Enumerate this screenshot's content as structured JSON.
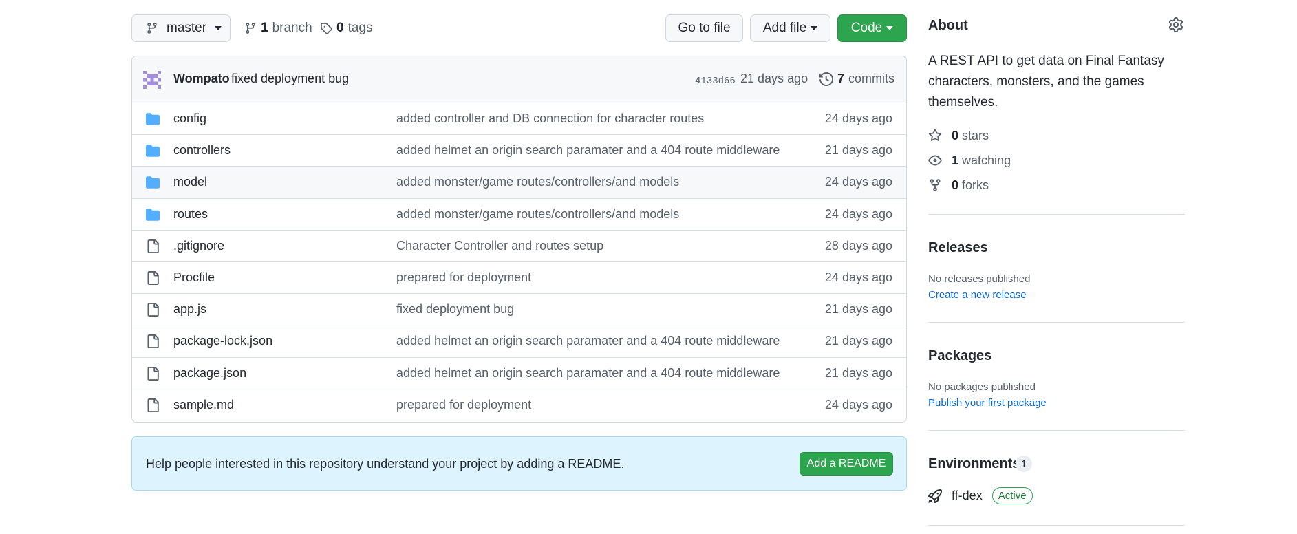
{
  "toolbar": {
    "branch_name": "master",
    "branch_count": "1",
    "branch_label": "branch",
    "tag_count": "0",
    "tag_label": "tags",
    "go_to_file": "Go to file",
    "add_file": "Add file",
    "code": "Code"
  },
  "commit": {
    "author": "Wompato",
    "message": "fixed deployment bug",
    "sha": "4133d66",
    "age": "21 days ago",
    "count": "7",
    "count_label": "commits"
  },
  "files": [
    {
      "name": "config",
      "type": "folder",
      "message": "added controller and DB connection for character routes",
      "age": "24 days ago"
    },
    {
      "name": "controllers",
      "type": "folder",
      "message": "added helmet an origin search paramater and a 404 route middleware",
      "age": "21 days ago"
    },
    {
      "name": "model",
      "type": "folder",
      "message": "added monster/game routes/controllers/and models",
      "age": "24 days ago"
    },
    {
      "name": "routes",
      "type": "folder",
      "message": "added monster/game routes/controllers/and models",
      "age": "24 days ago"
    },
    {
      "name": ".gitignore",
      "type": "file",
      "message": "Character Controller and routes setup",
      "age": "28 days ago"
    },
    {
      "name": "Procfile",
      "type": "file",
      "message": "prepared for deployment",
      "age": "24 days ago"
    },
    {
      "name": "app.js",
      "type": "file",
      "message": "fixed deployment bug",
      "age": "21 days ago"
    },
    {
      "name": "package-lock.json",
      "type": "file",
      "message": "added helmet an origin search paramater and a 404 route middleware",
      "age": "21 days ago"
    },
    {
      "name": "package.json",
      "type": "file",
      "message": "added helmet an origin search paramater and a 404 route middleware",
      "age": "21 days ago"
    },
    {
      "name": "sample.md",
      "type": "file",
      "message": "prepared for deployment",
      "age": "24 days ago"
    }
  ],
  "readme": {
    "text": "Help people interested in this repository understand your project by adding a README.",
    "button": "Add a README"
  },
  "about": {
    "title": "About",
    "description": "A REST API to get data on Final Fantasy characters, monsters, and the games themselves.",
    "stars_count": "0",
    "stars_label": "stars",
    "watching_count": "1",
    "watching_label": "watching",
    "forks_count": "0",
    "forks_label": "forks"
  },
  "releases": {
    "title": "Releases",
    "empty": "No releases published",
    "link": "Create a new release"
  },
  "packages": {
    "title": "Packages",
    "empty": "No packages published",
    "link": "Publish your first package"
  },
  "environments": {
    "title": "Environments",
    "count": "1",
    "items": [
      {
        "name": "ff-dex",
        "status": "Active"
      }
    ]
  },
  "colors": {
    "accent_green": "#2da44e",
    "link_blue": "#0969da",
    "folder_blue": "#54aeff",
    "readme_bg": "#ddf4ff"
  },
  "icons": {
    "folder": "folder-icon",
    "file": "file-icon",
    "branch": "git-branch-icon",
    "tag": "tag-icon",
    "history": "history-icon",
    "star": "star-icon",
    "eye": "eye-icon",
    "fork": "repo-forked-icon",
    "gear": "gear-icon",
    "rocket": "rocket-icon"
  }
}
